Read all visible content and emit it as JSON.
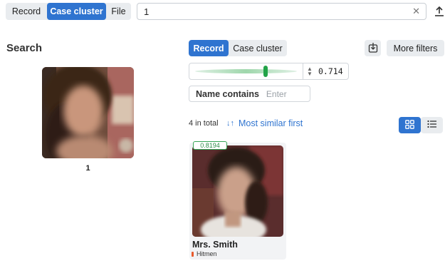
{
  "toolbar": {
    "tabs": [
      {
        "label": "Record",
        "active": false
      },
      {
        "label": "Case cluster",
        "active": true
      },
      {
        "label": "File",
        "active": false
      }
    ],
    "query_value": "1",
    "clear_icon": "close-icon",
    "upload_icon": "upload-icon"
  },
  "search": {
    "heading": "Search",
    "image_caption": "1"
  },
  "results_panel": {
    "mode_tabs": [
      {
        "label": "Record",
        "active": true
      },
      {
        "label": "Case cluster",
        "active": false
      }
    ],
    "download_icon": "download-icon",
    "more_filters_label": "More filters",
    "similarity_threshold": "0.714",
    "name_filter": {
      "label": "Name contains",
      "placeholder": "Enter"
    },
    "total_label": "4 in total",
    "sort_label": "Most similar first",
    "view_modes": [
      "grid",
      "list"
    ],
    "active_view": "grid"
  },
  "results": [
    {
      "score": "0.8194",
      "name": "Mrs. Smith",
      "group": "Hitmen",
      "group_color": "#e85a2c"
    }
  ],
  "colors": {
    "accent": "#2f74d0",
    "success": "#22a348"
  }
}
